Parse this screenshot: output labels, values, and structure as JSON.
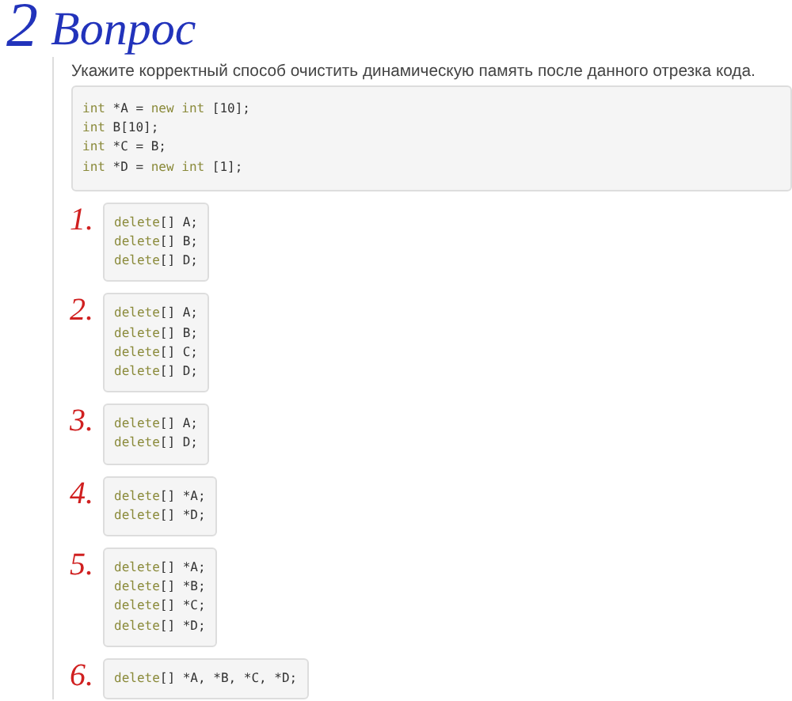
{
  "heading": {
    "number": "2",
    "title": "Вопрос"
  },
  "question": {
    "text": "Укажите корректный способ очистить динамическую память после данного отрезка кода.",
    "code": [
      [
        {
          "kind": "keyword",
          "text": "int"
        },
        {
          "kind": "plain",
          "text": " *A = "
        },
        {
          "kind": "keyword",
          "text": "new int"
        },
        {
          "kind": "plain",
          "text": " [10];"
        }
      ],
      [
        {
          "kind": "keyword",
          "text": "int"
        },
        {
          "kind": "plain",
          "text": " B[10];"
        }
      ],
      [
        {
          "kind": "keyword",
          "text": "int"
        },
        {
          "kind": "plain",
          "text": " *C = B;"
        }
      ],
      [
        {
          "kind": "keyword",
          "text": "int"
        },
        {
          "kind": "plain",
          "text": " *D = "
        },
        {
          "kind": "keyword",
          "text": "new int"
        },
        {
          "kind": "plain",
          "text": " [1];"
        }
      ]
    ]
  },
  "options": [
    {
      "number": "1.",
      "code": [
        [
          {
            "kind": "keyword",
            "text": "delete"
          },
          {
            "kind": "plain",
            "text": "[] A;"
          }
        ],
        [
          {
            "kind": "keyword",
            "text": "delete"
          },
          {
            "kind": "plain",
            "text": "[] B;"
          }
        ],
        [
          {
            "kind": "keyword",
            "text": "delete"
          },
          {
            "kind": "plain",
            "text": "[] D;"
          }
        ]
      ]
    },
    {
      "number": "2.",
      "code": [
        [
          {
            "kind": "keyword",
            "text": "delete"
          },
          {
            "kind": "plain",
            "text": "[] A;"
          }
        ],
        [
          {
            "kind": "keyword",
            "text": "delete"
          },
          {
            "kind": "plain",
            "text": "[] B;"
          }
        ],
        [
          {
            "kind": "keyword",
            "text": "delete"
          },
          {
            "kind": "plain",
            "text": "[] C;"
          }
        ],
        [
          {
            "kind": "keyword",
            "text": "delete"
          },
          {
            "kind": "plain",
            "text": "[] D;"
          }
        ]
      ]
    },
    {
      "number": "3.",
      "code": [
        [
          {
            "kind": "keyword",
            "text": "delete"
          },
          {
            "kind": "plain",
            "text": "[] A;"
          }
        ],
        [
          {
            "kind": "keyword",
            "text": "delete"
          },
          {
            "kind": "plain",
            "text": "[] D;"
          }
        ]
      ]
    },
    {
      "number": "4.",
      "code": [
        [
          {
            "kind": "keyword",
            "text": "delete"
          },
          {
            "kind": "plain",
            "text": "[] *A;"
          }
        ],
        [
          {
            "kind": "keyword",
            "text": "delete"
          },
          {
            "kind": "plain",
            "text": "[] *D;"
          }
        ]
      ]
    },
    {
      "number": "5.",
      "code": [
        [
          {
            "kind": "keyword",
            "text": "delete"
          },
          {
            "kind": "plain",
            "text": "[] *A;"
          }
        ],
        [
          {
            "kind": "keyword",
            "text": "delete"
          },
          {
            "kind": "plain",
            "text": "[] *B;"
          }
        ],
        [
          {
            "kind": "keyword",
            "text": "delete"
          },
          {
            "kind": "plain",
            "text": "[] *C;"
          }
        ],
        [
          {
            "kind": "keyword",
            "text": "delete"
          },
          {
            "kind": "plain",
            "text": "[] *D;"
          }
        ]
      ]
    },
    {
      "number": "6.",
      "code": [
        [
          {
            "kind": "keyword",
            "text": "delete"
          },
          {
            "kind": "plain",
            "text": "[] *A, *B, *C, *D;"
          }
        ]
      ]
    }
  ]
}
